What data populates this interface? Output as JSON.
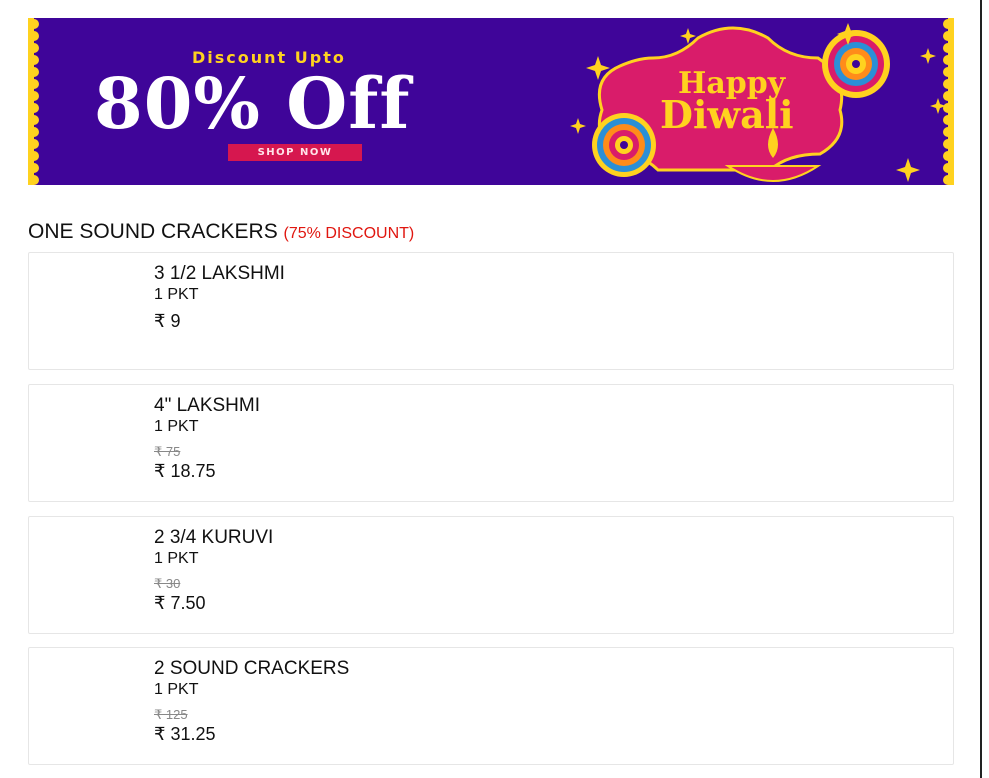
{
  "banner": {
    "discount_label": "Discount Upto",
    "headline": "80% Off",
    "cta_label": "SHOP NOW",
    "greeting_line1": "Happy",
    "greeting_line2": "Diwali",
    "colors": {
      "background": "#3f0599",
      "accent": "#ffd21f",
      "cta": "#d6174f",
      "frame": "#d91c6a"
    }
  },
  "section": {
    "title": "ONE SOUND CRACKERS",
    "discount": "(75% DISCOUNT)"
  },
  "products": [
    {
      "name": "3 1/2 LAKSHMI",
      "unit": "1 PKT",
      "old_price": "",
      "price": "₹ 9"
    },
    {
      "name": "4\" LAKSHMI",
      "unit": "1 PKT",
      "old_price": "₹ 75",
      "price": "₹ 18.75"
    },
    {
      "name": "2 3/4 KURUVI",
      "unit": "1 PKT",
      "old_price": "₹ 30",
      "price": "₹ 7.50"
    },
    {
      "name": "2 SOUND CRACKERS",
      "unit": "1 PKT",
      "old_price": "₹ 125",
      "price": "₹ 31.25"
    }
  ]
}
